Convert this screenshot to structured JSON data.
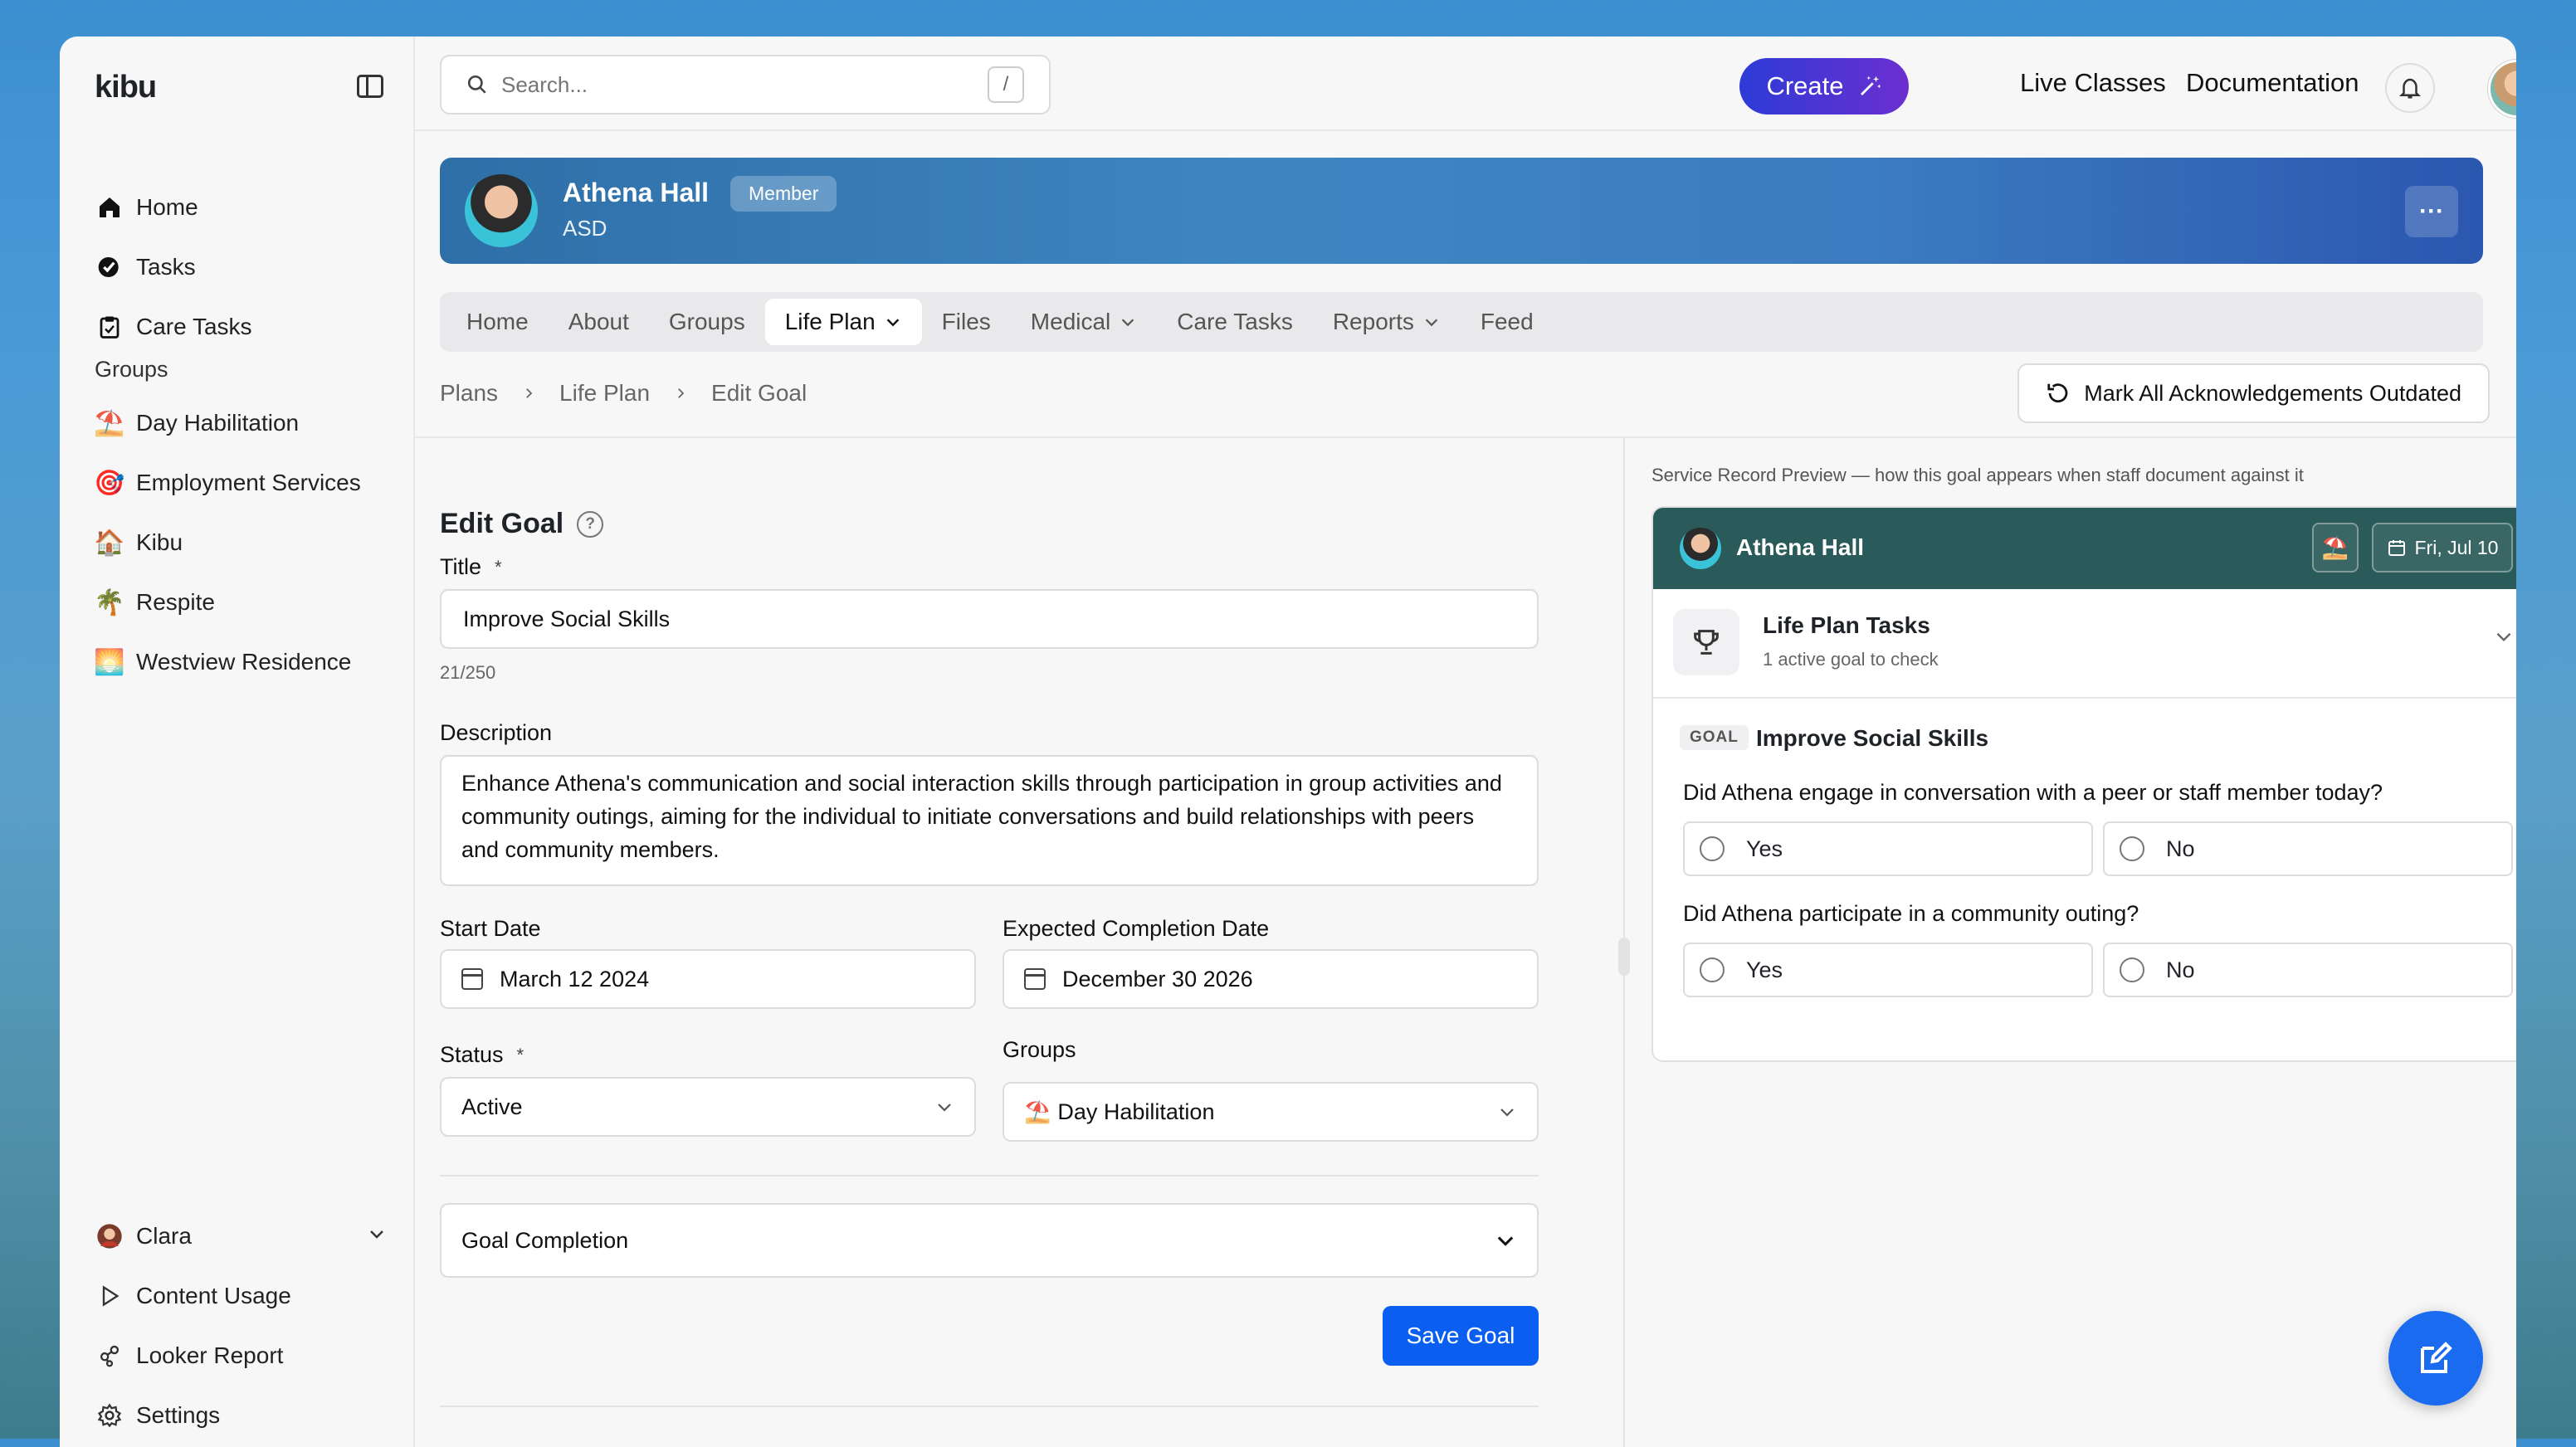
{
  "app": {
    "logo": "kibu"
  },
  "sidebar": {
    "nav": [
      {
        "label": "Home",
        "icon": "home-icon"
      },
      {
        "label": "Tasks",
        "icon": "tasks-icon"
      },
      {
        "label": "Care Tasks",
        "icon": "clipboard-icon"
      }
    ],
    "groups_label": "Groups",
    "groups": [
      {
        "label": "Day Habilitation",
        "emoji": "⛱️"
      },
      {
        "label": "Employment Services",
        "emoji": "🎯"
      },
      {
        "label": "Kibu",
        "emoji": "🏠"
      },
      {
        "label": "Respite",
        "emoji": "🌴"
      },
      {
        "label": "Westview Residence",
        "emoji": "🌅"
      }
    ],
    "footer": [
      {
        "label": "Clara",
        "icon": "user-avatar"
      },
      {
        "label": "Content Usage",
        "icon": "play-icon"
      },
      {
        "label": "Looker Report",
        "icon": "share-icon"
      },
      {
        "label": "Settings",
        "icon": "gear-icon"
      }
    ]
  },
  "topbar": {
    "search_placeholder": "Search...",
    "search_shortcut": "/",
    "create_label": "Create",
    "links": [
      "Live Classes",
      "Documentation"
    ]
  },
  "profile": {
    "name": "Athena Hall",
    "badge": "Member",
    "subtitle": "ASD",
    "more": "···"
  },
  "tabs": [
    {
      "label": "Home",
      "has_menu": false,
      "active": false
    },
    {
      "label": "About",
      "has_menu": false,
      "active": false
    },
    {
      "label": "Groups",
      "has_menu": false,
      "active": false
    },
    {
      "label": "Life Plan",
      "has_menu": true,
      "active": true
    },
    {
      "label": "Files",
      "has_menu": false,
      "active": false
    },
    {
      "label": "Medical",
      "has_menu": true,
      "active": false
    },
    {
      "label": "Care Tasks",
      "has_menu": false,
      "active": false
    },
    {
      "label": "Reports",
      "has_menu": true,
      "active": false
    },
    {
      "label": "Feed",
      "has_menu": false,
      "active": false
    }
  ],
  "breadcrumb": [
    "Plans",
    "Life Plan",
    "Edit Goal"
  ],
  "mark_outdated_label": "Mark All Acknowledgements Outdated",
  "form": {
    "title": "Edit Goal",
    "title_label": "Title",
    "required_mark": "*",
    "title_value": "Improve Social Skills",
    "title_counter": "21/250",
    "description_label": "Description",
    "description_value": "Enhance Athena's communication and social interaction skills through participation in group activities and community outings, aiming for the individual to initiate conversations and build relationships with peers and community members.",
    "start_date_label": "Start Date",
    "start_date_value": "March 12 2024",
    "completion_date_label": "Expected Completion Date",
    "completion_date_value": "December 30 2026",
    "status_label": "Status",
    "status_value": "Active",
    "groups_label": "Groups",
    "groups_value": "Day Habilitation",
    "groups_emoji": "⛱️",
    "goal_completion_label": "Goal Completion",
    "save_label": "Save Goal"
  },
  "preview": {
    "caption": "Service Record Preview — how this goal appears when staff document against it",
    "name": "Athena Hall",
    "chip_emoji": "⛱️",
    "date": "Fri, Jul 10",
    "section_title": "Life Plan Tasks",
    "section_sub": "1 active goal to check",
    "goal_tag": "GOAL",
    "goal_name": "Improve Social Skills",
    "questions": [
      {
        "text": "Did Athena engage in conversation with a peer or staff member today?",
        "options": [
          "Yes",
          "No"
        ]
      },
      {
        "text": "Did Athena participate in a community outing?",
        "options": [
          "Yes",
          "No"
        ]
      }
    ]
  },
  "colors": {
    "primary": "#0a5ff0",
    "banner": "#3e86c2",
    "preview_header": "#2a5a5a"
  }
}
